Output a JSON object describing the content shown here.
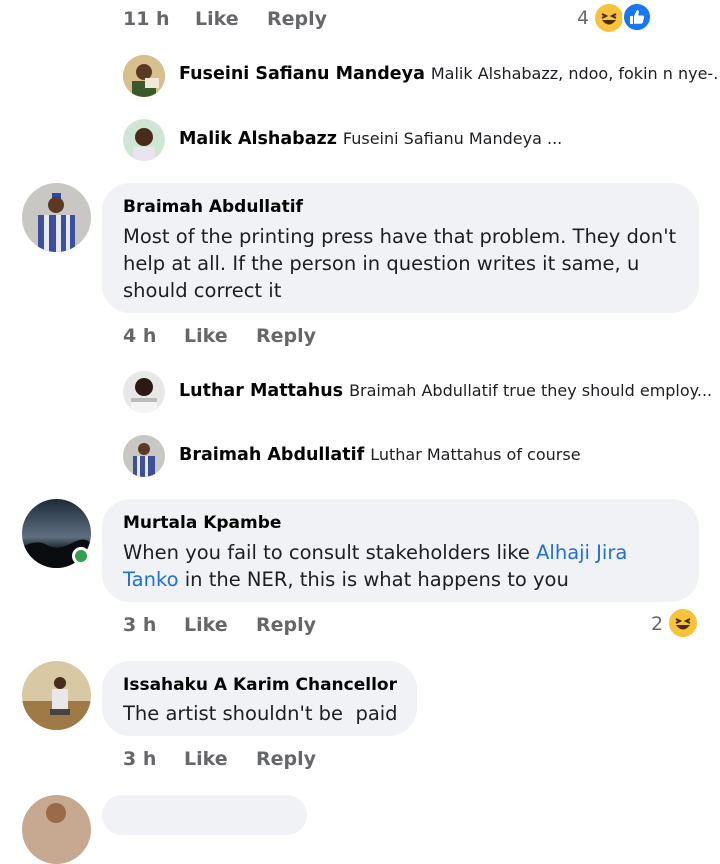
{
  "top_comment_meta": {
    "time": "11 h",
    "like": "Like",
    "reply": "Reply",
    "reaction_count": "4"
  },
  "replies_1": [
    {
      "name": "Fuseini Safianu Mandeya",
      "text": "Malik Alshabazz, ndoo, fokin n nye-..."
    },
    {
      "name": "Malik Alshabazz",
      "text": "Fuseini Safianu Mandeya ..."
    }
  ],
  "comment_braimah": {
    "author": "Braimah Abdullatif",
    "lines": [
      "Most of the printing press have that problem. They don't",
      "help at all. If the person in question writes it same, u",
      "should correct it"
    ],
    "time": "4 h",
    "like": "Like",
    "reply": "Reply"
  },
  "replies_2": [
    {
      "name": "Luthar Mattahus",
      "text": "Braimah Abdullatif true they should employ..."
    },
    {
      "name": "Braimah Abdullatif",
      "text": "Luthar Mattahus of course"
    }
  ],
  "comment_murtala": {
    "author": "Murtala Kpambe",
    "line1_prefix": "When you fail to consult stakeholders like ",
    "line1_link": "Alhaji Jira",
    "line2_link": "Tanko",
    "line2_suffix": " in the NER, this is what happens to you",
    "time": "3 h",
    "like": "Like",
    "reply": "Reply",
    "reaction_count": "2"
  },
  "comment_issahaku": {
    "author": "Issahaku A Karim Chancellor",
    "text": "The artist shouldn't be  paid",
    "time": "3 h",
    "like": "Like",
    "reply": "Reply"
  },
  "icons": {
    "laugh": "laugh-reaction-icon",
    "like": "like-reaction-icon"
  },
  "colors": {
    "bubble": "#f0f2f5",
    "link": "#216fdb",
    "meta": "#65676b",
    "online": "#31a24c"
  }
}
